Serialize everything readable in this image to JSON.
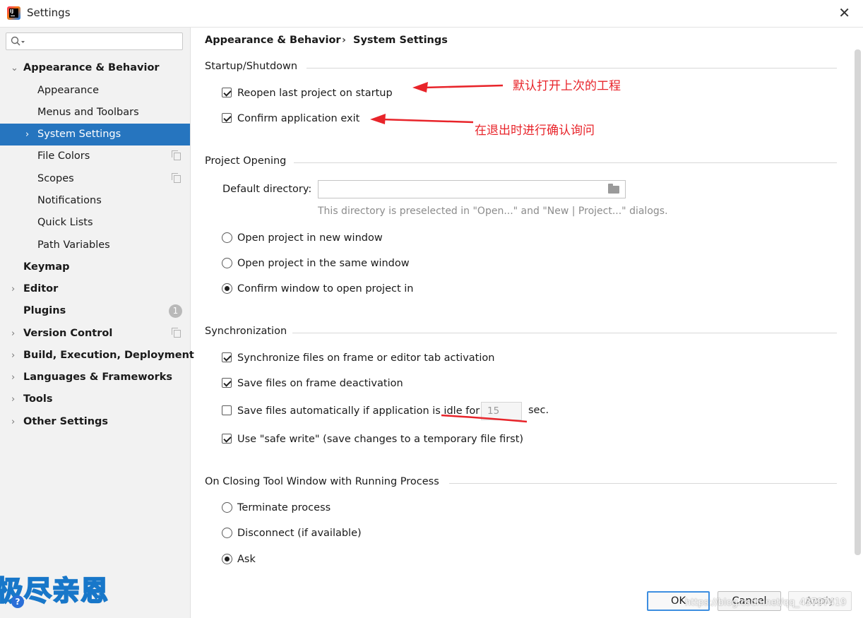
{
  "window": {
    "title": "Settings"
  },
  "search": {
    "placeholder": ""
  },
  "sidebar": {
    "items": [
      {
        "label": "Appearance & Behavior"
      },
      {
        "label": "Appearance"
      },
      {
        "label": "Menus and Toolbars"
      },
      {
        "label": "System Settings"
      },
      {
        "label": "File Colors"
      },
      {
        "label": "Scopes"
      },
      {
        "label": "Notifications"
      },
      {
        "label": "Quick Lists"
      },
      {
        "label": "Path Variables"
      },
      {
        "label": "Keymap"
      },
      {
        "label": "Editor"
      },
      {
        "label": "Plugins",
        "badge": "1"
      },
      {
        "label": "Version Control"
      },
      {
        "label": "Build, Execution, Deployment"
      },
      {
        "label": "Languages & Frameworks"
      },
      {
        "label": "Tools"
      },
      {
        "label": "Other Settings"
      }
    ]
  },
  "breadcrumb": {
    "parent": "Appearance & Behavior",
    "separator": "›",
    "current": "System Settings"
  },
  "startup": {
    "title": "Startup/Shutdown",
    "reopen": {
      "label": "Reopen last project on startup",
      "checked": true
    },
    "confirm_exit": {
      "label": "Confirm application exit",
      "checked": true
    }
  },
  "project_opening": {
    "title": "Project Opening",
    "default_dir_label": "Default directory:",
    "default_dir_value": "",
    "hint": "This directory is preselected in \"Open...\" and \"New | Project...\" dialogs.",
    "options": [
      {
        "label": "Open project in new window",
        "selected": false
      },
      {
        "label": "Open project in the same window",
        "selected": false
      },
      {
        "label": "Confirm window to open project in",
        "selected": true
      }
    ]
  },
  "sync": {
    "title": "Synchronization",
    "sync_files": {
      "label": "Synchronize files on frame or editor tab activation",
      "checked": true
    },
    "save_deactivation": {
      "label": "Save files on frame deactivation",
      "checked": true
    },
    "save_idle": {
      "label": "Save files automatically if application is idle for",
      "checked": false,
      "value": "15",
      "unit": "sec."
    },
    "safe_write": {
      "label": "Use \"safe write\" (save changes to a temporary file first)",
      "checked": true
    }
  },
  "closing": {
    "title": "On Closing Tool Window with Running Process",
    "options": [
      {
        "label": "Terminate process",
        "selected": false
      },
      {
        "label": "Disconnect (if available)",
        "selected": false
      },
      {
        "label": "Ask",
        "selected": true
      }
    ]
  },
  "annotations": {
    "reopen_note": "默认打开上次的工程",
    "exit_note": "在退出时进行确认询问",
    "color": "#e8242a"
  },
  "footer": {
    "ok": "OK",
    "cancel": "Cancel",
    "apply": "Apply",
    "help": "?",
    "watermark": "https://blog.csdn.net/qq_43797419",
    "logo_text": "极尽亲恩"
  },
  "colors": {
    "selection": "#2675bf",
    "sidebar_bg": "#f2f2f2",
    "focus_border": "#3d8ee0"
  }
}
